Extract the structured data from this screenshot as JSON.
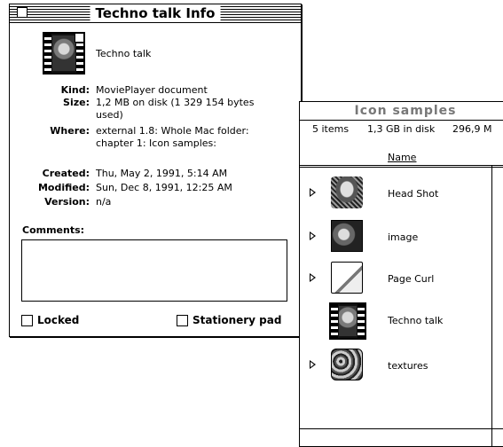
{
  "info_window": {
    "title": "Techno talk Info",
    "doc_name": "Techno talk",
    "fields": [
      {
        "label": "Kind:",
        "value": "MoviePlayer document"
      },
      {
        "label": "Size:",
        "value": "1,2 MB on disk (1 329 154 bytes used)"
      },
      {
        "label": "Where:",
        "value": "external 1.8: Whole Mac folder: chapter 1: Icon samples:"
      },
      {
        "label": "Created:",
        "value": "Thu, May 2, 1991, 5:14 AM"
      },
      {
        "label": "Modified:",
        "value": "Sun, Dec 8, 1991, 12:25 AM"
      },
      {
        "label": "Version:",
        "value": "n/a"
      }
    ],
    "comments_label": "Comments:",
    "locked_label": "Locked",
    "stationery_label": "Stationery pad"
  },
  "finder_window": {
    "title": "Icon samples",
    "items_count": "5 items",
    "disk_usage": "1,3 GB in disk",
    "available": "296,9 M",
    "column_name": "Name",
    "items": [
      {
        "name": "Head Shot",
        "icon": "head-shot-icon",
        "expandable": true
      },
      {
        "name": "image",
        "icon": "image-icon",
        "expandable": true
      },
      {
        "name": "Page Curl",
        "icon": "folder-icon",
        "expandable": true
      },
      {
        "name": "Techno talk",
        "icon": "movie-icon",
        "expandable": false
      },
      {
        "name": "textures",
        "icon": "textures-icon",
        "expandable": true
      }
    ]
  }
}
